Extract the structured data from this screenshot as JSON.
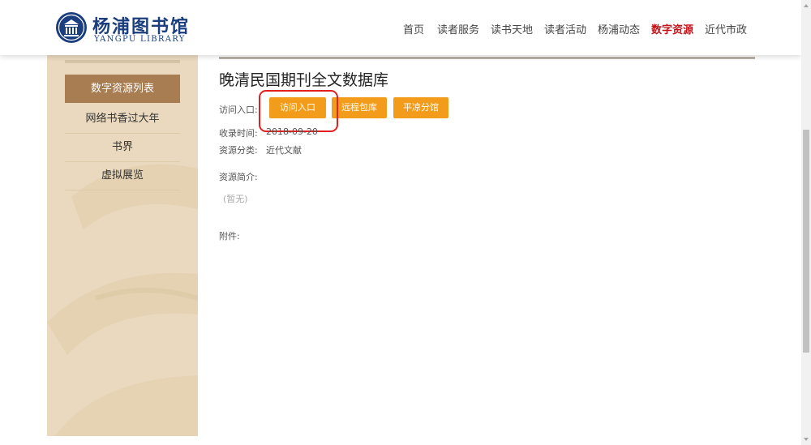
{
  "header": {
    "logo_cn": "杨浦图书馆",
    "logo_en": "YANGPU LIBRARY",
    "nav": [
      {
        "label": "首页",
        "active": false
      },
      {
        "label": "读者服务",
        "active": false
      },
      {
        "label": "读书天地",
        "active": false
      },
      {
        "label": "读者活动",
        "active": false
      },
      {
        "label": "杨浦动态",
        "active": false
      },
      {
        "label": "数字资源",
        "active": true
      },
      {
        "label": "近代市政",
        "active": false
      }
    ]
  },
  "sidebar": {
    "items": [
      {
        "label": "数字资源列表",
        "active": true
      },
      {
        "label": "网络书香过大年",
        "active": false
      },
      {
        "label": "书界",
        "active": false
      },
      {
        "label": "虚拟展览",
        "active": false
      }
    ]
  },
  "content": {
    "title": "晚清民国期刊全文数据库",
    "access_label": "访问入口:",
    "buttons": [
      "访问入口",
      "远程包库",
      "平凉分馆"
    ],
    "date_label": "收录时间:",
    "date_value": "2018-09-20",
    "category_label": "资源分类:",
    "category_value": "近代文献",
    "intro_label": "资源简介:",
    "intro_value": "(暂无)",
    "attachment_label": "附件:"
  },
  "colors": {
    "accent_orange": "#f39c1b",
    "nav_active_red": "#c6131a",
    "sidebar_bg": "#ead9be",
    "sidebar_active": "#a87d52",
    "highlight_red": "#e0211f",
    "logo_blue": "#1b3f7e"
  }
}
